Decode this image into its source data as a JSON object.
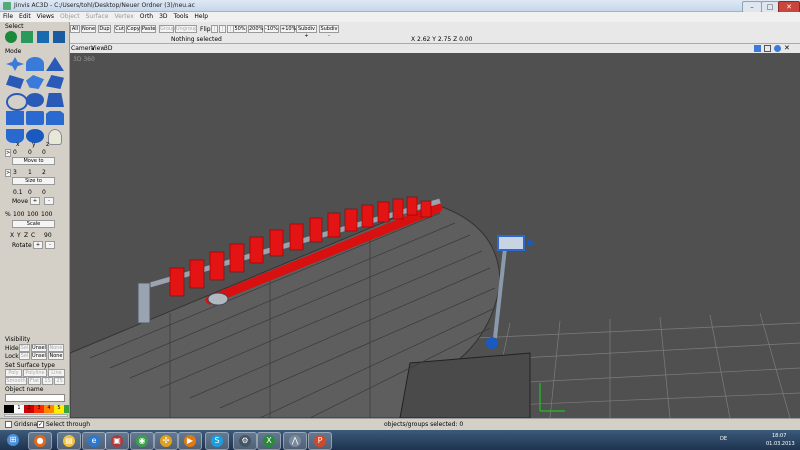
{
  "window": {
    "title": "Jinvis AC3D - C:/Users/tohl/Desktop/Neuer Ordner (3)/neu.ac",
    "min": "–",
    "max": "□",
    "close": "✕"
  },
  "menu": [
    {
      "label": "File",
      "enabled": true
    },
    {
      "label": "Edit",
      "enabled": true
    },
    {
      "label": "Views",
      "enabled": true
    },
    {
      "label": "Object",
      "enabled": false
    },
    {
      "label": "Surface",
      "enabled": false
    },
    {
      "label": "Vertex",
      "enabled": false
    },
    {
      "label": "Orth",
      "enabled": true
    },
    {
      "label": "3D",
      "enabled": true
    },
    {
      "label": "Tools",
      "enabled": true
    },
    {
      "label": "Help",
      "enabled": true
    }
  ],
  "left": {
    "select_label": "Select",
    "mode_label": "Mode",
    "xyz_headers": [
      "x",
      "y",
      "z"
    ],
    "move_vals": [
      "0",
      "0",
      "0"
    ],
    "move_to": "Move to",
    "size_vals": [
      "3",
      "1",
      "2"
    ],
    "size_to": "Size to",
    "move_step_vals": [
      "0.1",
      "0",
      "0"
    ],
    "move_label": "Move",
    "plus": "+",
    "minus": "-",
    "scale_pct": "%",
    "scale_vals": [
      "100",
      "100",
      "100"
    ],
    "scale_label": "Scale",
    "axes": [
      "X",
      "Y",
      "Z",
      "C"
    ],
    "rotate_val": "90",
    "rotate_label": "Rotate",
    "visibility_label": "Visibility",
    "hide_label": "Hide:",
    "lock_label": "Lock:",
    "set": "Sel",
    "unsel": "Unsel",
    "none": "None",
    "surface_type_label": "Set Surface type",
    "surf_row1": [
      "Poly",
      "Polyline",
      "Line"
    ],
    "surf_row2": [
      "Smooth",
      "Flat",
      "1S",
      "2S"
    ],
    "object_name_label": "Object name",
    "palette_labels": [
      "1",
      "2",
      "3",
      "4",
      "5"
    ],
    "palette_colors": [
      "#000000",
      "#ffffff",
      "#cc0000",
      "#ff2a00",
      "#ff8800",
      "#ffee00"
    ]
  },
  "toolbar": {
    "all": "All",
    "none": "None",
    "dup": "Dup",
    "cut": "Cut",
    "copy": "Copy",
    "paste": "Paste",
    "group": "Group",
    "ungroup": "Ungroup",
    "flip": "Flip:",
    "zoom": [
      "50%",
      "200%",
      "-10%",
      "+10%"
    ],
    "subdiv_plus": "Subdiv +",
    "subdiv_minus": "Subdiv -",
    "selection_status": "Nothing selected",
    "coords": "X 2.62 Y 2.75 Z 0.00"
  },
  "view": {
    "camera": "Camera",
    "view": "View",
    "mode": "3D",
    "overlay": "3D 360"
  },
  "status": {
    "gridsnap": "Gridsnap",
    "select_through": "Select through",
    "select_through_checked": true,
    "selected": "objects/groups selected: 0"
  },
  "taskbar": {
    "lang": "DE",
    "time": "18:07",
    "date": "01.03.2013",
    "apps": [
      {
        "name": "start-orb",
        "color": "#4a8fd8",
        "glyph": "⊞"
      },
      {
        "name": "firefox-app",
        "color": "#e06a1a",
        "glyph": "●"
      },
      {
        "name": "explorer-app",
        "color": "#f0c040",
        "glyph": "▤"
      },
      {
        "name": "ie-app",
        "color": "#2a78d0",
        "glyph": "e"
      },
      {
        "name": "media-app",
        "color": "#b03a3a",
        "glyph": "▣"
      },
      {
        "name": "chrome-app",
        "color": "#3aa04a",
        "glyph": "◉"
      },
      {
        "name": "share-app",
        "color": "#e0a020",
        "glyph": "✣"
      },
      {
        "name": "player-app",
        "color": "#e07a10",
        "glyph": "▶"
      },
      {
        "name": "skype-app",
        "color": "#1aa0e0",
        "glyph": "S"
      },
      {
        "name": "steam-app",
        "color": "#445566",
        "glyph": "⚙"
      },
      {
        "name": "excel-app",
        "color": "#2a8a3a",
        "glyph": "X"
      },
      {
        "name": "ac3d-app",
        "color": "#7a8a9a",
        "glyph": "⋀"
      },
      {
        "name": "ppt-app",
        "color": "#d04a2a",
        "glyph": "P"
      }
    ]
  }
}
